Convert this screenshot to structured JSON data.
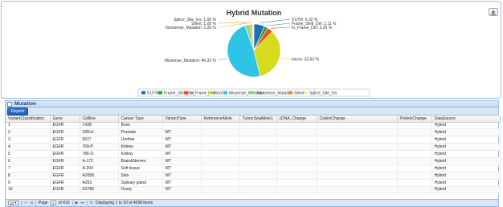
{
  "chart_data": {
    "type": "pie",
    "title": "Hybrid Mutation",
    "categories": [
      "5'UTR",
      "Frame_Shift_Del",
      "In_Frame_Del",
      "Intron",
      "Missense_Mutation",
      "Nonsense_Mutation",
      "Silent",
      "Splice_Site_Ins"
    ],
    "values": [
      6.32,
      2.11,
      3.26,
      32.63,
      46.32,
      3.26,
      1.05,
      1.05
    ],
    "colors": [
      "#1f6fb4",
      "#2ca02c",
      "#e8511b",
      "#d6db1d",
      "#2ec4e6",
      "#8fd98a",
      "#f28b30",
      "#f7f29a"
    ],
    "slice_labels": [
      "5'UTR: 6.32 %",
      "Frame_Shift_Del: 2.11 %",
      "In_Frame_Del: 3.26 %",
      "Intron: 32.63 %",
      "Missense_Mutation: 46.32 %",
      "Nonsense_Mutation: 3.26 %",
      "Silent: 1.05 %",
      "Splice_Site_Ins: 1.05 %"
    ],
    "legend_position": "bottom"
  },
  "panel": {
    "title": "Mutation",
    "export_label": "Export"
  },
  "table": {
    "columns": [
      "VariantClassification",
      "Gene",
      "Cellline",
      "Cancer Type",
      "VariantType",
      "ReferenceAllele",
      "TumorSeqAllele1",
      "cDNA_Change",
      "CodonChange",
      "ProteinChange",
      "DataSource"
    ],
    "rows": [
      [
        "1",
        "EGFR",
        "143B",
        "Bone",
        "",
        "",
        "",
        "",
        "",
        "",
        "Hybrid"
      ],
      [
        "2",
        "EGFR",
        "22Rv1",
        "Prostate",
        "WT",
        "",
        "",
        "",
        "",
        "",
        "Hybrid"
      ],
      [
        "3",
        "EGFR",
        "5637",
        "Urethra",
        "WT",
        "",
        "",
        "",
        "",
        "",
        "Hybrid"
      ],
      [
        "4",
        "EGFR",
        "769-P",
        "Kidney",
        "WT",
        "",
        "",
        "",
        "",
        "",
        "Hybrid"
      ],
      [
        "5",
        "EGFR",
        "786-O",
        "Kidney",
        "WT",
        "",
        "",
        "",
        "",
        "",
        "Hybrid"
      ],
      [
        "6",
        "EGFR",
        "A-172",
        "Brain&Nerves",
        "WT",
        "",
        "",
        "",
        "",
        "",
        "Hybrid"
      ],
      [
        "7",
        "EGFR",
        "A-204",
        "Soft tissue",
        "WT",
        "",
        "",
        "",
        "",
        "",
        "Hybrid"
      ],
      [
        "8",
        "EGFR",
        "A2058",
        "Skin",
        "WT",
        "",
        "",
        "",
        "",
        "",
        "Hybrid"
      ],
      [
        "9",
        "EGFR",
        "A253",
        "Salivary gland",
        "WT",
        "",
        "",
        "",
        "",
        "",
        "Hybrid"
      ],
      [
        "10",
        "EGFR",
        "A2780",
        "Ovary",
        "WT",
        "",
        "",
        "",
        "",
        "",
        "Hybrid"
      ]
    ]
  },
  "pager": {
    "page_size": "10",
    "page_label": "Page",
    "page_value": "1",
    "of_label": "of 410",
    "display_text": "Displaying 1 to 10 of 4098 items",
    "first_icon": "⏮",
    "prev_icon": "◀",
    "next_icon": "▶",
    "last_icon": "⏭",
    "refresh_icon": "↻"
  }
}
